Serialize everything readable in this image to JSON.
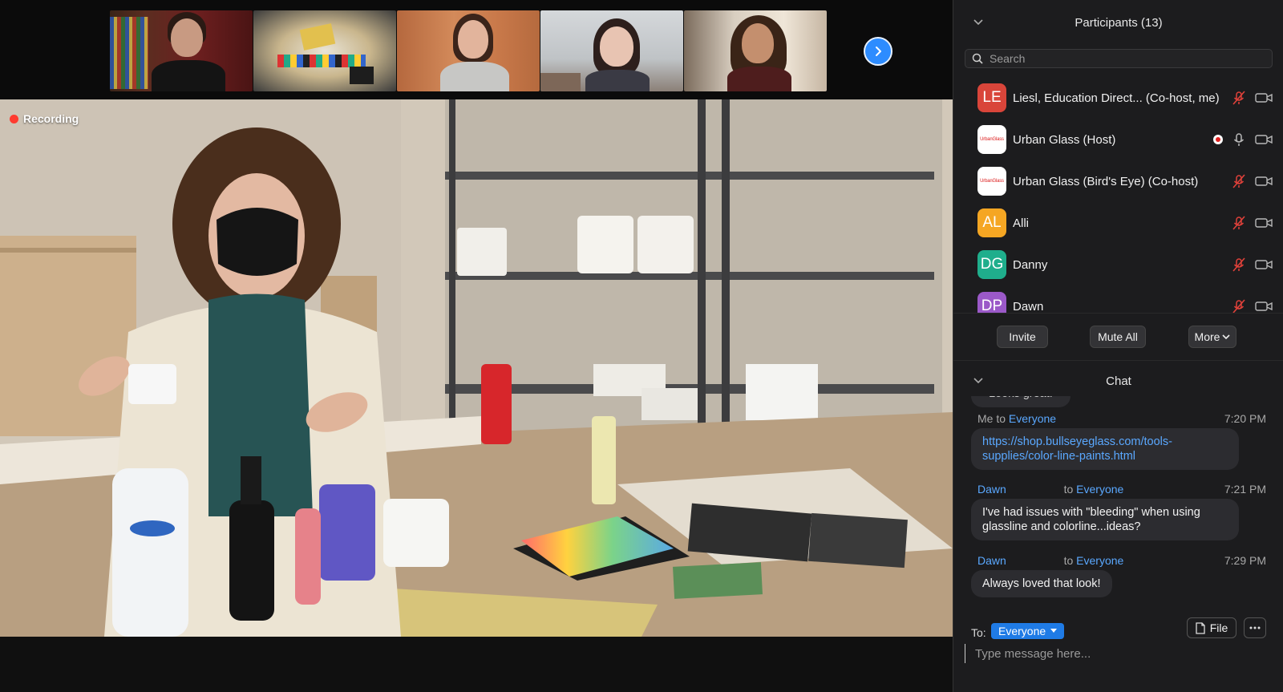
{
  "recording": {
    "label": "Recording"
  },
  "participants_panel": {
    "title": "Participants (13)",
    "search_placeholder": "Search",
    "list": [
      {
        "initials": "LE",
        "name": "Liesl, Education Direct...",
        "role": "(Co-host, me)",
        "avatar_color": "#d9453a",
        "logo": false,
        "muted": true,
        "recording": false
      },
      {
        "initials": "UrbanGlass",
        "name": "Urban Glass (Host)",
        "role": "",
        "avatar_color": "#ffffff",
        "logo": true,
        "muted": false,
        "recording": true
      },
      {
        "initials": "UrbanGlass",
        "name": "Urban Glass (Bird's Eye) (Co-host)",
        "role": "",
        "avatar_color": "#ffffff",
        "logo": true,
        "muted": true,
        "recording": false
      },
      {
        "initials": "AL",
        "name": "Alli",
        "role": "",
        "avatar_color": "#f5a623",
        "logo": false,
        "muted": true,
        "recording": false
      },
      {
        "initials": "DG",
        "name": "Danny",
        "role": "",
        "avatar_color": "#1fae8c",
        "logo": false,
        "muted": true,
        "recording": false
      },
      {
        "initials": "DP",
        "name": "Dawn",
        "role": "",
        "avatar_color": "#9b59c8",
        "logo": false,
        "muted": true,
        "recording": false
      }
    ],
    "buttons": {
      "invite": "Invite",
      "mute_all": "Mute All",
      "more": "More"
    }
  },
  "chat": {
    "title": "Chat",
    "partial_message": "Looks great!",
    "messages": [
      {
        "sender": "Me",
        "to_prefix": "to",
        "recipient": "Everyone",
        "time": "7:20 PM",
        "text": "https://shop.bullseyeglass.com/tools-supplies/color-line-paints.html",
        "text_line1": "https://shop.bullseyeglass.com/tools-",
        "text_line2": "supplies/color-line-paints.html"
      },
      {
        "sender": "Dawn",
        "to_prefix": "to",
        "recipient": "Everyone",
        "time": "7:21 PM",
        "text_line1": "I've had issues with \"bleeding\" when using",
        "text_line2": "glassline and colorline...ideas?"
      },
      {
        "sender": "Dawn",
        "to_prefix": "to",
        "recipient": "Everyone",
        "time": "7:29 PM",
        "text_line1": "Always loved that look!"
      }
    ],
    "to_label": "To:",
    "recipient_selected": "Everyone",
    "file_label": "File",
    "input_placeholder": "Type message here..."
  },
  "colors": {
    "accent": "#2d8cff",
    "link": "#5aa8ff",
    "muted_icon": "#e0413a",
    "panel_bg": "#1c1c1e"
  }
}
